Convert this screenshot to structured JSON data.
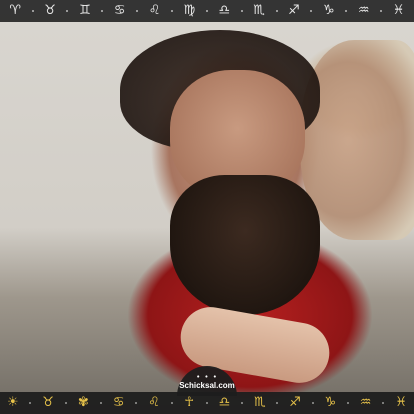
{
  "top_bar": {
    "zodiac": [
      {
        "name": "aries-icon",
        "glyph": "♈"
      },
      {
        "name": "taurus-icon",
        "glyph": "♉"
      },
      {
        "name": "gemini-icon",
        "glyph": "♊"
      },
      {
        "name": "cancer-icon",
        "glyph": "♋"
      },
      {
        "name": "leo-icon",
        "glyph": "♌"
      },
      {
        "name": "virgo-icon",
        "glyph": "♍"
      },
      {
        "name": "libra-icon",
        "glyph": "♎"
      },
      {
        "name": "scorpio-icon",
        "glyph": "♏"
      },
      {
        "name": "sagittarius-icon",
        "glyph": "♐"
      },
      {
        "name": "capricorn-icon",
        "glyph": "♑"
      },
      {
        "name": "aquarius-icon",
        "glyph": "♒"
      },
      {
        "name": "pisces-icon",
        "glyph": "♓"
      }
    ]
  },
  "logo": {
    "text": "Schicksal.com",
    "dots": "• • •"
  },
  "bottom_bar": {
    "symbols": [
      {
        "name": "sun-icon",
        "glyph": "☀"
      },
      {
        "name": "bull-icon",
        "glyph": "♉"
      },
      {
        "name": "butterfly-icon",
        "glyph": "✾"
      },
      {
        "name": "crab-icon",
        "glyph": "♋"
      },
      {
        "name": "lion-icon",
        "glyph": "♌"
      },
      {
        "name": "angel-icon",
        "glyph": "☥"
      },
      {
        "name": "scales-icon",
        "glyph": "♎"
      },
      {
        "name": "scorpion-icon",
        "glyph": "♏"
      },
      {
        "name": "archer-icon",
        "glyph": "♐"
      },
      {
        "name": "goat-icon",
        "glyph": "♑"
      },
      {
        "name": "water-bearer-icon",
        "glyph": "♒"
      },
      {
        "name": "fish-icon",
        "glyph": "♓"
      }
    ]
  },
  "colors": {
    "bar_background": "#262626",
    "top_icon": "#e9e9e9",
    "bottom_icon": "#e8c34a"
  }
}
